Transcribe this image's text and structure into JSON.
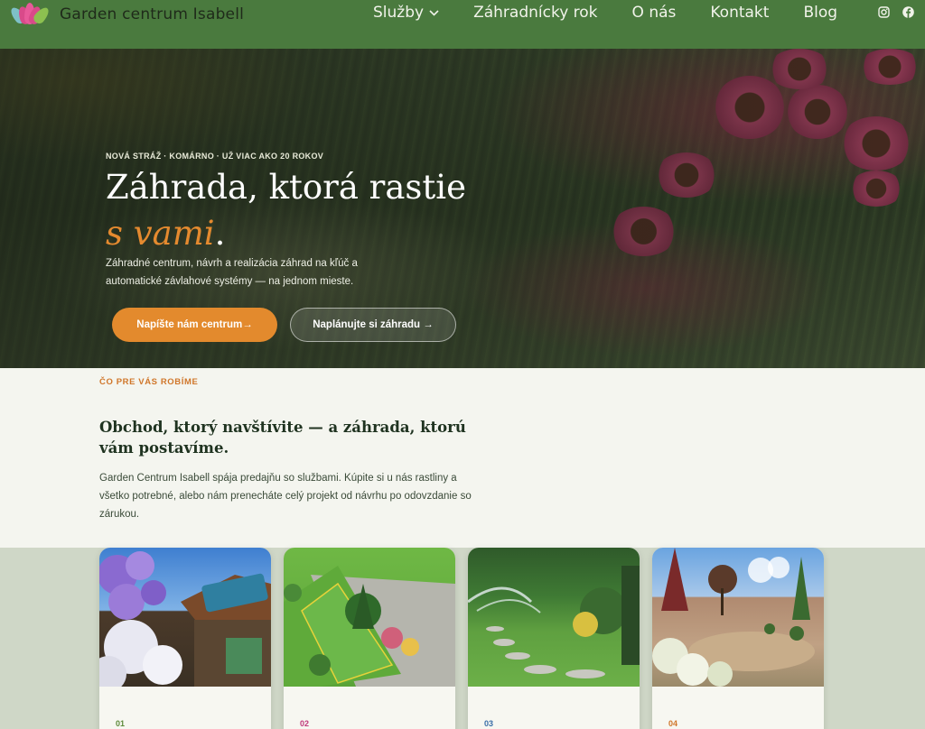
{
  "header": {
    "brand_name": "Garden centrum Isabell",
    "nav": [
      {
        "label": "Služby",
        "has_dropdown": true
      },
      {
        "label": "Záhradnícky rok"
      },
      {
        "label": "O nás"
      },
      {
        "label": "Kontakt"
      },
      {
        "label": "Blog"
      }
    ],
    "social": [
      "instagram-icon",
      "facebook-icon"
    ]
  },
  "hero": {
    "eyebrow": "NOVÁ STRÁŽ · KOMÁRNO · UŽ VIAC AKO 20 ROKOV",
    "title_main": "Záhrada, ktorá rastie ",
    "title_accent": "s vami",
    "title_end": ".",
    "subtitle": "Záhradné centrum, návrh a realizácia záhrad na kľúč a automatické závlahové systémy — na jednom mieste.",
    "primary_button": "Napíšte nám centrum→",
    "secondary_button": "Naplánujte si záhradu →"
  },
  "intro": {
    "tag": "ČO PRE VÁS ROBÍME",
    "title": "Obchod, ktorý navštívite — a záhrada, ktorú vám postavíme.",
    "text": "Garden Centrum Isabell spája predajňu so službami. Kúpite si u nás rastliny a všetko potrebné, alebo nám prenecháte celý projekt od návrhu po odovzdanie so zárukou."
  },
  "cards": [
    {
      "number": "01",
      "color": "#5e8a3a"
    },
    {
      "number": "02",
      "color": "#c0397a"
    },
    {
      "number": "03",
      "color": "#3a6fa8"
    },
    {
      "number": "04",
      "color": "#d0762a"
    }
  ],
  "colors": {
    "header_bg": "#4a7a3e",
    "accent_orange": "#e38a2d",
    "page_bg": "#f4f5ef",
    "cards_band_bg": "#cfd7c7"
  }
}
